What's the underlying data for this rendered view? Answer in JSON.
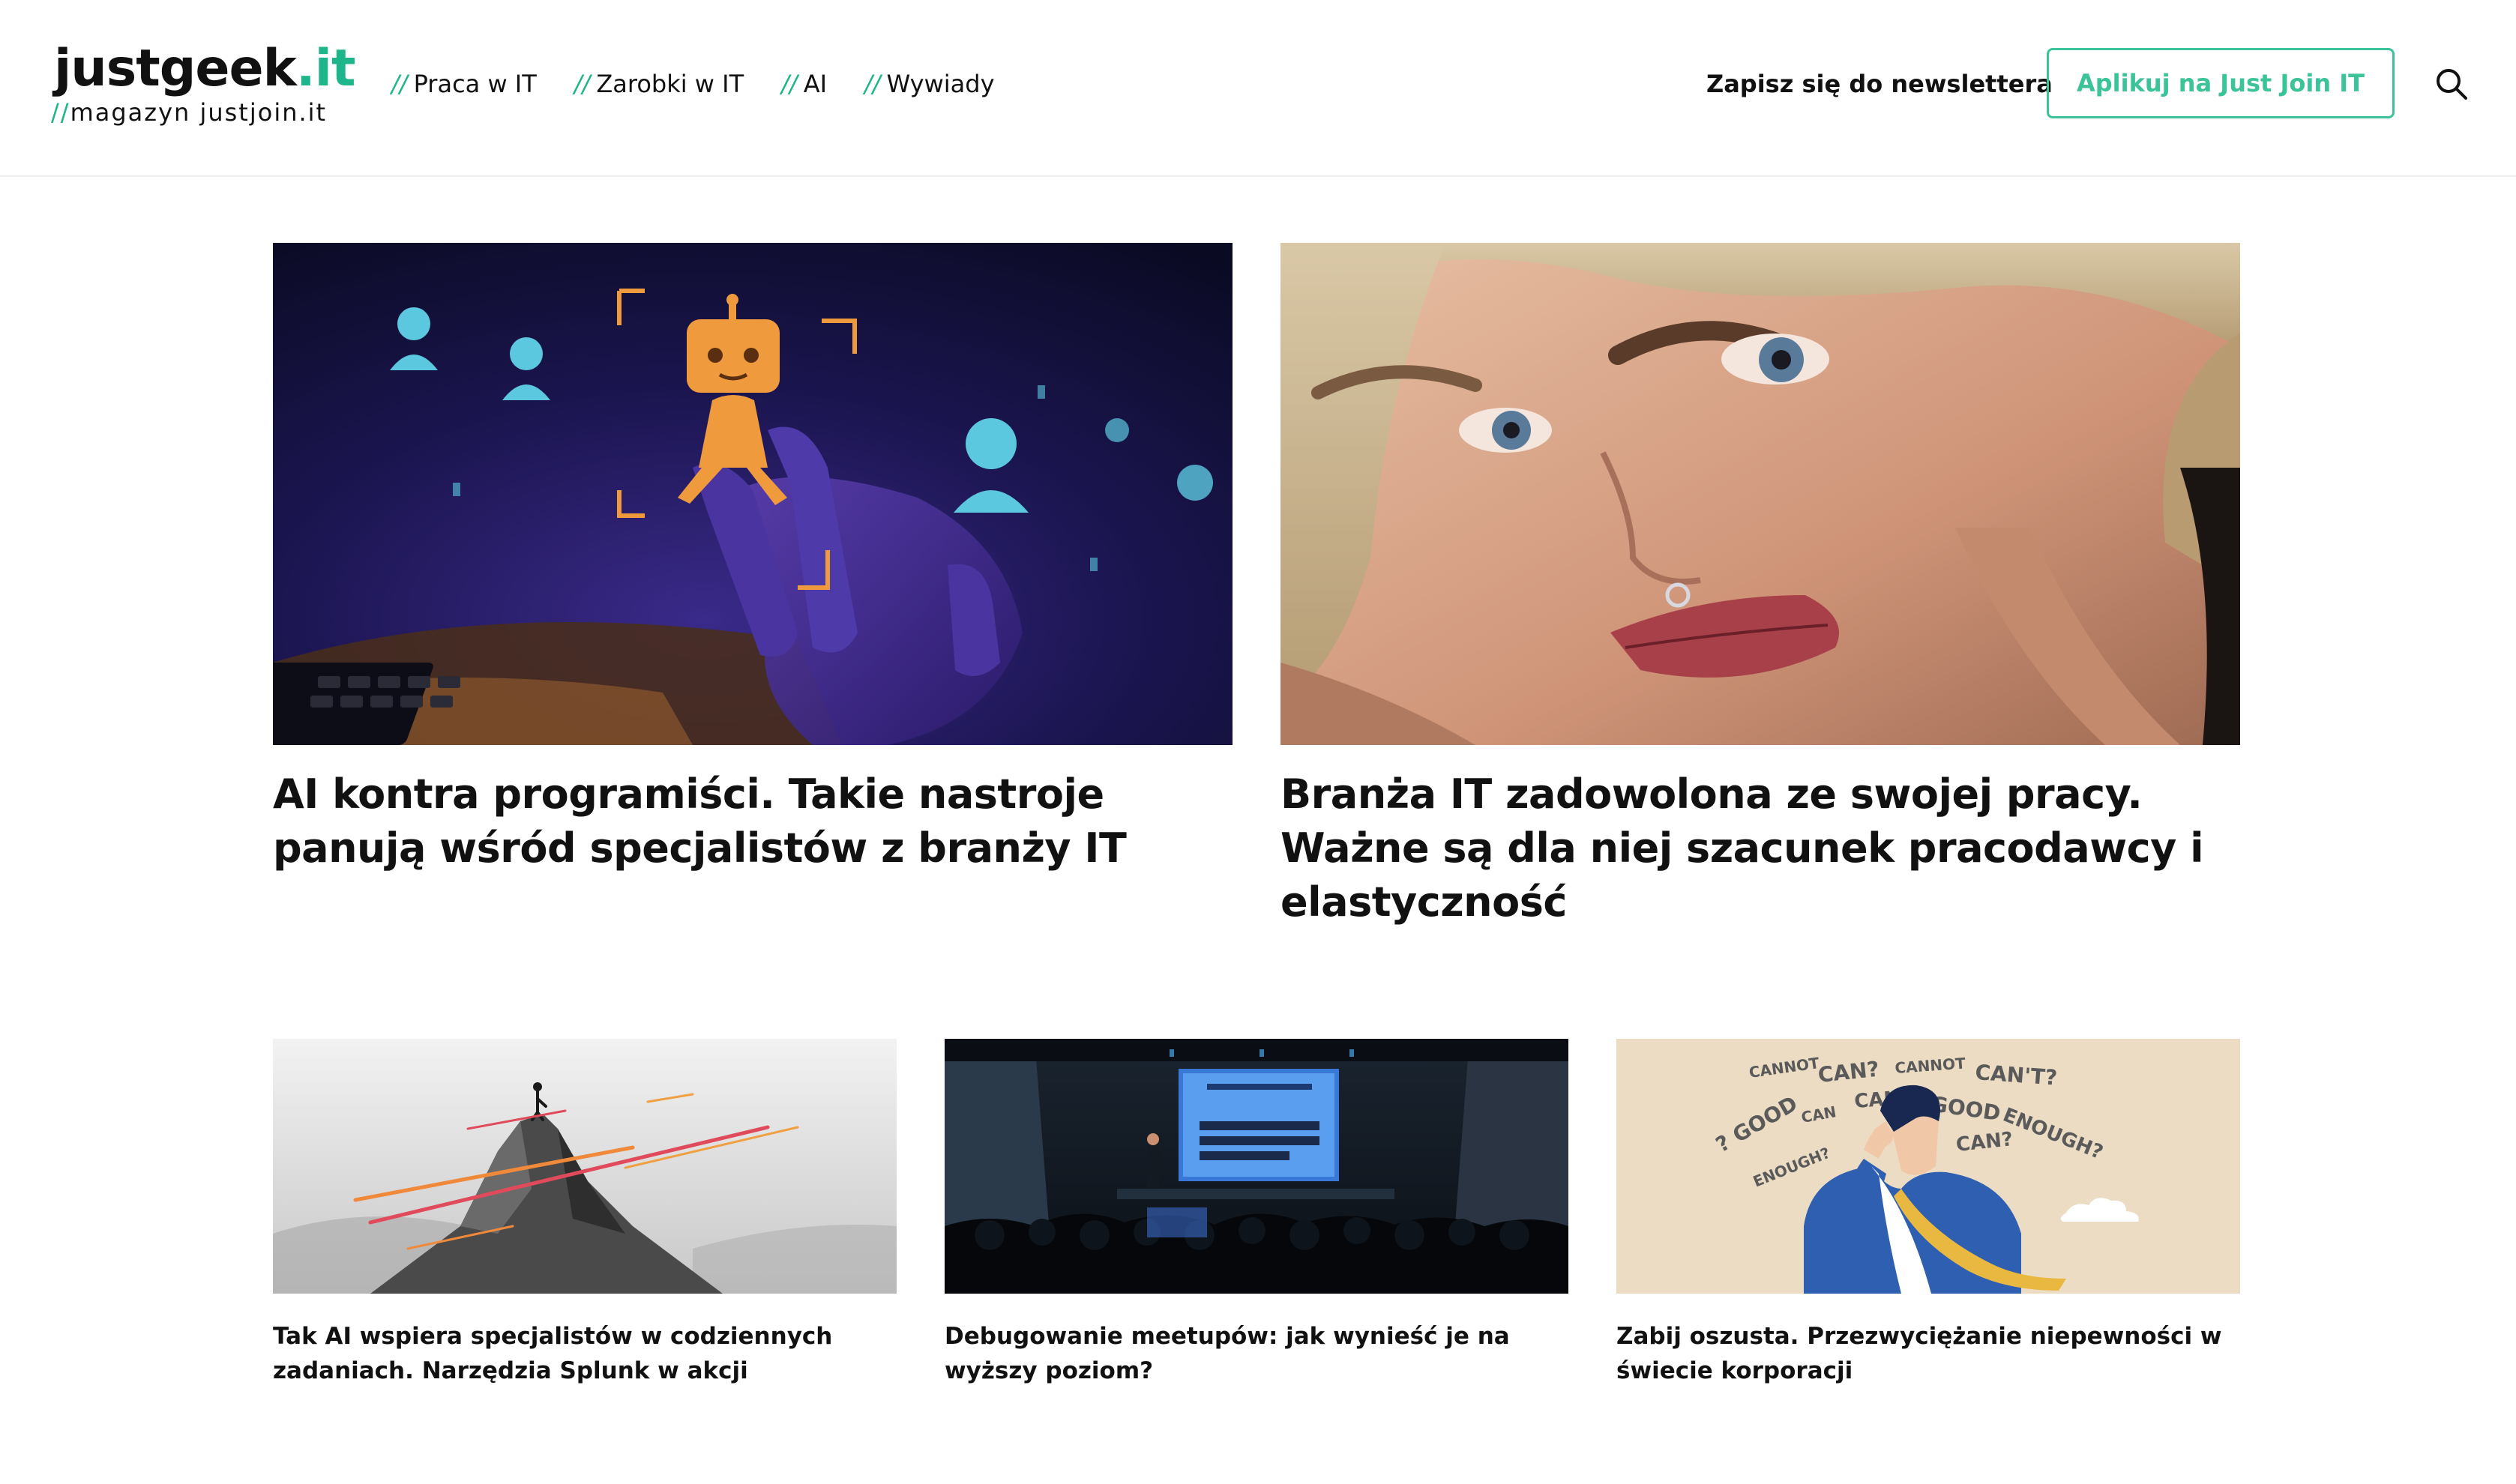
{
  "brand": {
    "name_main": "justgeek",
    "name_accent": ".it",
    "tagline_slash": "//",
    "tagline": "magazyn justjoin.it",
    "accent_color": "#1fb58a"
  },
  "nav": {
    "slash": "//",
    "items": [
      {
        "label": "Praca w IT"
      },
      {
        "label": "Zarobki w IT"
      },
      {
        "label": "AI"
      },
      {
        "label": "Wywiady"
      }
    ]
  },
  "header_actions": {
    "newsletter_label": "Zapisz się do newslettera",
    "apply_label": "Aplikuj na Just Join IT",
    "search_icon": "search-icon"
  },
  "featured": [
    {
      "title": "AI kontra programiści. Takie nastroje panują wśród specjalistów z branży IT"
    },
    {
      "title": "Branża IT zadowolona ze swojej pracy. Ważne są dla niej szacunek pracodawcy i elastyczność"
    }
  ],
  "latest": [
    {
      "title": "Tak AI wspiera specjalistów w codziennych zadaniach. Narzędzia Splunk w akcji"
    },
    {
      "title": "Debugowanie meetupów: jak wynieść je na wyższy poziom?"
    },
    {
      "title": "Zabij oszusta. Przezwyciężanie niepewności w świecie korporacji",
      "illustration_words": [
        "CANNOT",
        "CAN?",
        "CANNOT",
        "CAN'T?",
        "? GOOD",
        "CAN",
        "CAN'T?",
        "GOOD",
        "ENOUGH?",
        "ENOUGH?",
        "CAN?"
      ]
    }
  ]
}
